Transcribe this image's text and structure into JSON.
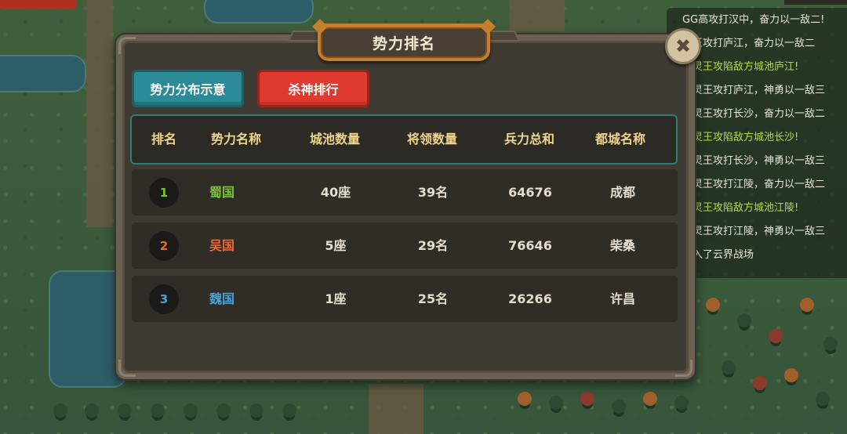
{
  "panel": {
    "title": "势力排名"
  },
  "tabs": [
    {
      "label": "势力分布示意",
      "color": "#2a8a95"
    },
    {
      "label": "杀神排行",
      "color": "#e03a2e"
    }
  ],
  "table": {
    "headers": [
      "排名",
      "势力名称",
      "城池数量",
      "将领数量",
      "兵力总和",
      "都城名称"
    ],
    "rows": [
      {
        "rank": "1",
        "name": "蜀国",
        "cities": "40座",
        "generals": "39名",
        "troops": "64676",
        "capital": "成都",
        "color": "#7cc33a"
      },
      {
        "rank": "2",
        "name": "吴国",
        "cities": "5座",
        "generals": "29名",
        "troops": "76646",
        "capital": "柴桑",
        "color": "#e86a3a"
      },
      {
        "rank": "3",
        "name": "魏国",
        "cities": "1座",
        "generals": "25名",
        "troops": "26266",
        "capital": "许昌",
        "color": "#4aa3d8"
      }
    ]
  },
  "battle_log": [
    {
      "text": "GG高攻打汉中，奋力以一敌二!",
      "highlight": false
    },
    {
      "text": "灵王攻打庐江，奋力以一敌二",
      "highlight": false
    },
    {
      "text": "武灵王攻陷敌方城池庐江!",
      "highlight": true
    },
    {
      "text": "武灵王攻打庐江，神勇以一敌三",
      "highlight": false
    },
    {
      "text": "武灵王攻打长沙，奋力以一敌二",
      "highlight": false
    },
    {
      "text": "武灵王攻陷敌方城池长沙!",
      "highlight": true
    },
    {
      "text": "武灵王攻打长沙，神勇以一敌三",
      "highlight": false
    },
    {
      "text": "武灵王攻打江陵，奋力以一敌二",
      "highlight": false
    },
    {
      "text": "武灵王攻陷敌方城池江陵!",
      "highlight": true
    },
    {
      "text": "武灵王攻打江陵，神勇以一敌三",
      "highlight": false
    },
    {
      "text": "进入了云界战场",
      "highlight": false
    }
  ],
  "icons": {
    "close": "close-icon"
  }
}
